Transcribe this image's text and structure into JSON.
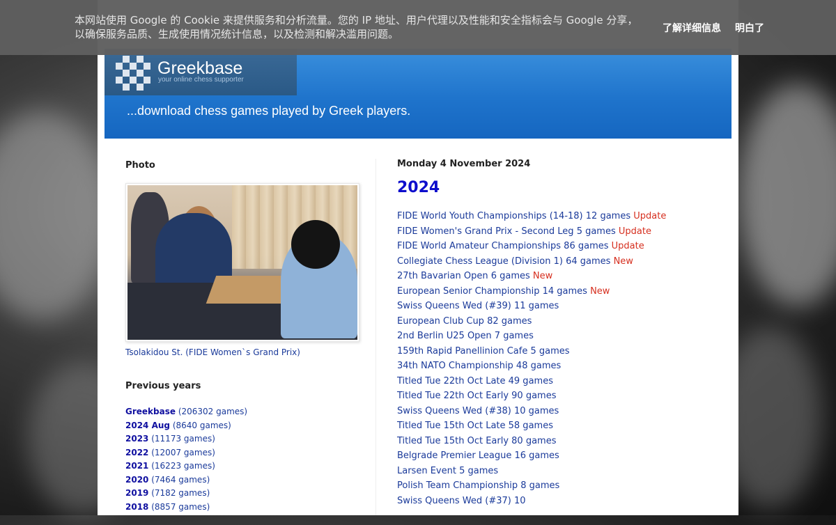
{
  "cookie": {
    "text": "本网站使用 Google 的 Cookie 来提供服务和分析流量。您的 IP 地址、用户代理以及性能和安全指标会与 Google 分享，以确保服务品质、生成使用情况统计信息，以及检测和解决滥用问题。",
    "learn_more": "了解详细信息",
    "ok": "明白了"
  },
  "header": {
    "logo_title": "Greekbase",
    "logo_subtitle": "your online chess supporter",
    "tagline": "...download chess games played by Greek players."
  },
  "sidebar": {
    "photo_title": "Photo",
    "photo_caption": "Tsolakidou St. (FIDE Women`s Grand Prix)",
    "previous_title": "Previous years",
    "years": [
      {
        "label": "Greekbase",
        "count": "(206302 games)"
      },
      {
        "label": "2024 Aug",
        "count": "(8640 games)"
      },
      {
        "label": "2023",
        "count": "(11173 games)"
      },
      {
        "label": "2022",
        "count": "(12007 games)"
      },
      {
        "label": "2021",
        "count": "(16223 games)"
      },
      {
        "label": "2020",
        "count": "(7464 games)"
      },
      {
        "label": "2019",
        "count": "(7182 games)"
      },
      {
        "label": "2018",
        "count": "(8857 games)"
      }
    ]
  },
  "main": {
    "date": "Monday 4 November 2024",
    "title": "2024",
    "games": [
      {
        "text": "FIDE World Youth Championships (14-18) 12 games",
        "tag": "Update"
      },
      {
        "text": "FIDE Women's Grand Prix - Second Leg 5 games",
        "tag": "Update"
      },
      {
        "text": "FIDE World Amateur Championships 86 games",
        "tag": "Update"
      },
      {
        "text": "Collegiate Chess League (Division 1) 64 games",
        "tag": "New"
      },
      {
        "text": "27th Bavarian Open 6 games",
        "tag": "New"
      },
      {
        "text": "European Senior Championship 14 games",
        "tag": "New"
      },
      {
        "text": "Swiss Queens Wed (#39) 11 games",
        "tag": ""
      },
      {
        "text": "European Club Cup 82 games",
        "tag": ""
      },
      {
        "text": "2nd Berlin U25 Open 7 games",
        "tag": ""
      },
      {
        "text": "159th Rapid Panellinion Cafe 5 games",
        "tag": ""
      },
      {
        "text": "34th NATO Championship 48 games",
        "tag": ""
      },
      {
        "text": "Titled Tue 22th Oct Late 49 games",
        "tag": ""
      },
      {
        "text": "Titled Tue 22th Oct Early 90 games",
        "tag": ""
      },
      {
        "text": "Swiss Queens Wed (#38) 10 games",
        "tag": ""
      },
      {
        "text": "Titled Tue 15th Oct Late 58 games",
        "tag": ""
      },
      {
        "text": "Titled Tue 15th Oct Early 80 games",
        "tag": ""
      },
      {
        "text": "Belgrade Premier League 16 games",
        "tag": ""
      },
      {
        "text": "Larsen Event 5 games",
        "tag": ""
      },
      {
        "text": "Polish Team Championship 8 games",
        "tag": ""
      },
      {
        "text": "Swiss Queens Wed (#37) 10",
        "tag": ""
      }
    ]
  }
}
